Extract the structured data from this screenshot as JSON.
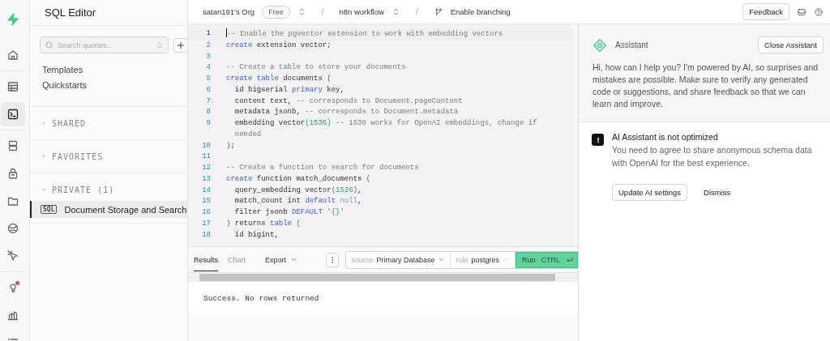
{
  "rail": {
    "groups": [
      [
        {
          "selected": false,
          "notification": false
        },
        {
          "selected": false,
          "notification": false
        }
      ],
      [
        {
          "selected": false,
          "notification": false
        },
        {
          "selected": true,
          "notification": false
        }
      ],
      [
        {
          "selected": false,
          "notification": false
        },
        {
          "selected": false,
          "notification": false
        },
        {
          "selected": false,
          "notification": false
        },
        {
          "selected": false,
          "notification": false
        },
        {
          "selected": false,
          "notification": false
        }
      ],
      [
        {
          "selected": false,
          "notification": true
        },
        {
          "selected": false,
          "notification": false
        },
        {
          "selected": false,
          "notification": false
        }
      ]
    ]
  },
  "sidebar": {
    "title": "SQL Editor",
    "search": {
      "placeholder": "Search queries..."
    },
    "links": [
      "Templates",
      "Quickstarts"
    ],
    "sections": [
      {
        "label": "SHARED",
        "expanded": false
      },
      {
        "label": "FAVORITES",
        "expanded": false
      },
      {
        "label": "PRIVATE (1)",
        "expanded": true,
        "items": [
          {
            "badge": "SQL",
            "label": "Document Storage and Search",
            "selected": true
          }
        ]
      }
    ]
  },
  "breadcrumb": {
    "org": "satan191's Org",
    "plan": "Free",
    "separators": [
      "/",
      "/"
    ],
    "project": "n8n workflow",
    "branching": "Enable branching"
  },
  "topbar_actions": {
    "feedback": "Feedback"
  },
  "editor": {
    "lines": [
      {
        "n": "1",
        "active": true,
        "tokens": [
          {
            "comment": "-- Enable the pgvector extension to work with embedding vectors"
          }
        ]
      },
      {
        "n": "2",
        "active": false,
        "tokens": [
          {
            "keyword": "create"
          },
          {
            "text": " extension vector;"
          }
        ]
      },
      {
        "n": "3",
        "active": false
      },
      {
        "n": "4",
        "active": false,
        "tokens": [
          {
            "comment": "-- Create a table to store your documents"
          }
        ]
      },
      {
        "n": "5",
        "active": false,
        "tokens": [
          {
            "keyword": "create table"
          },
          {
            "text": " documents "
          },
          {
            "paren": "("
          }
        ]
      },
      {
        "n": "6",
        "active": false,
        "tokens": [
          {
            "text": "  id bigserial "
          },
          {
            "keyword": "primary"
          },
          {
            "text": " key,"
          }
        ]
      },
      {
        "n": "7",
        "active": false,
        "tokens": [
          {
            "text": "  content text, "
          },
          {
            "comment": "-- corresponds to Document.pageContent"
          }
        ]
      },
      {
        "n": "8",
        "active": false,
        "tokens": [
          {
            "text": "  metadata jsonb, "
          },
          {
            "comment": "-- corresponds to Document.metadata"
          }
        ]
      },
      {
        "n": "9",
        "active": false,
        "tokens": [
          {
            "text": "  embedding vector"
          },
          {
            "number": "(1536)"
          },
          {
            "comment": " -- 1536 works for OpenAI embeddings, change if needed"
          }
        ]
      },
      {
        "n": "10",
        "active": false,
        "tokens": [
          {
            "paren": ")"
          },
          {
            "text": ";"
          }
        ]
      },
      {
        "n": "11",
        "active": false
      },
      {
        "n": "12",
        "active": false,
        "tokens": [
          {
            "comment": "-- Create a function to search for documents"
          }
        ]
      },
      {
        "n": "13",
        "active": false,
        "tokens": [
          {
            "keyword": "create"
          },
          {
            "text": " function match_documents "
          },
          {
            "paren": "("
          }
        ]
      },
      {
        "n": "14",
        "active": false,
        "tokens": [
          {
            "text": "  query_embedding vector"
          },
          {
            "number": "(1536)"
          },
          {
            "text": ","
          }
        ]
      },
      {
        "n": "15",
        "active": false,
        "tokens": [
          {
            "text": "  match_count int "
          },
          {
            "keyword": "default"
          },
          {
            "null": " null"
          },
          {
            "text": ","
          }
        ]
      },
      {
        "n": "16",
        "active": false,
        "tokens": [
          {
            "text": "  filter jsonb "
          },
          {
            "keyword": "DEFAULT"
          },
          {
            "number": " '{}'"
          }
        ]
      },
      {
        "n": "17",
        "active": false,
        "tokens": [
          {
            "paren": ")"
          },
          {
            "text": " returns "
          },
          {
            "keyword": "table"
          },
          {
            "paren": " ("
          }
        ]
      },
      {
        "n": "18",
        "active": false,
        "tokens": [
          {
            "text": "  id bigint,"
          }
        ]
      }
    ]
  },
  "results": {
    "tabs": [
      {
        "label": "Results",
        "selected": true
      },
      {
        "label": "Chart",
        "selected": false
      }
    ],
    "export": "Export",
    "source": {
      "label": "source",
      "value": "Primary Database"
    },
    "role": {
      "label": "role",
      "value": "postgres"
    },
    "run": {
      "label": "Run",
      "shortcut": "CTRL"
    },
    "message": "Success. No rows returned"
  },
  "assistant": {
    "title": "Assistant",
    "close": "Close Assistant",
    "intro": "Hi, how can I help you? I'm powered by AI, so surprises and mistakes are possible. Make sure to verify any generated code or suggestions, and share feedback so that we can learn and improve.",
    "notice": {
      "title": "AI Assistant is not optimized",
      "text": "You need to agree to share anonymous schema data with OpenAI for the best experience.",
      "primary": "Update AI settings",
      "secondary": "Dismiss"
    }
  }
}
